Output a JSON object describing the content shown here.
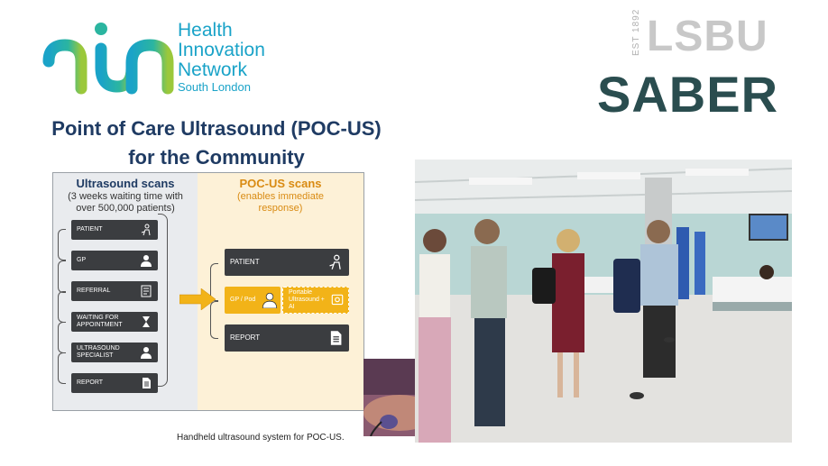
{
  "logo_hin": {
    "mark": "hin",
    "line1": "Health",
    "line2": "Innovation",
    "line3": "Network",
    "line4": "South London"
  },
  "logo_lsbu": {
    "est": "EST 1892",
    "name": "LSBU",
    "saber": "SABER"
  },
  "title": {
    "line1": "Point of Care Ultrasound (POC-US)",
    "line2": "for the Community"
  },
  "left_panel": {
    "heading": "Ultrasound scans",
    "sub1": "(3 weeks waiting time with",
    "sub2": "over 500,000 patients)",
    "steps": [
      {
        "label": "PATIENT",
        "icon": "patient-icon"
      },
      {
        "label": "GP",
        "icon": "doctor-icon"
      },
      {
        "label": "REFERRAL",
        "icon": "document-icon"
      },
      {
        "label": "WAITING FOR APPOINTMENT",
        "icon": "hourglass-icon"
      },
      {
        "label": "ULTRASOUND SPECIALIST",
        "icon": "specialist-icon"
      },
      {
        "label": "REPORT",
        "icon": "report-icon"
      }
    ]
  },
  "right_panel": {
    "heading": "POC-US scans",
    "sub1": "(enables immediate",
    "sub2": "response)",
    "steps": [
      {
        "label": "PATIENT",
        "icon": "patient-icon"
      },
      {
        "label": "GP / Pod",
        "icon": "doctor-icon",
        "extra": "Portable Ultrasound + AI"
      },
      {
        "label": "REPORT",
        "icon": "report-icon"
      }
    ]
  },
  "caption": "Handheld ultrasound system for POC-US.",
  "colors": {
    "title": "#1f3b63",
    "accent_orange": "#d98b13",
    "box_dark": "#3b3d40",
    "box_yellow": "#f2b318",
    "hin_blue": "#1aa3c8"
  }
}
